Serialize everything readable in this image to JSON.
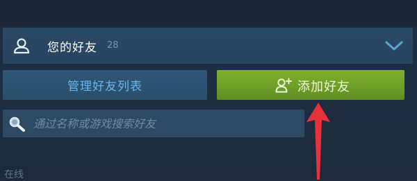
{
  "friends": {
    "title": "您的好友",
    "count": "28"
  },
  "actions": {
    "manage_label": "管理好友列表",
    "add_label": "添加好友"
  },
  "search": {
    "placeholder": "通过名称或游戏搜索好友",
    "value": ""
  },
  "sections": {
    "online_label": "在线"
  },
  "colors": {
    "add_button": "#6e9f27",
    "manage_text": "#69b6ee",
    "arrow": "#e8313a"
  }
}
